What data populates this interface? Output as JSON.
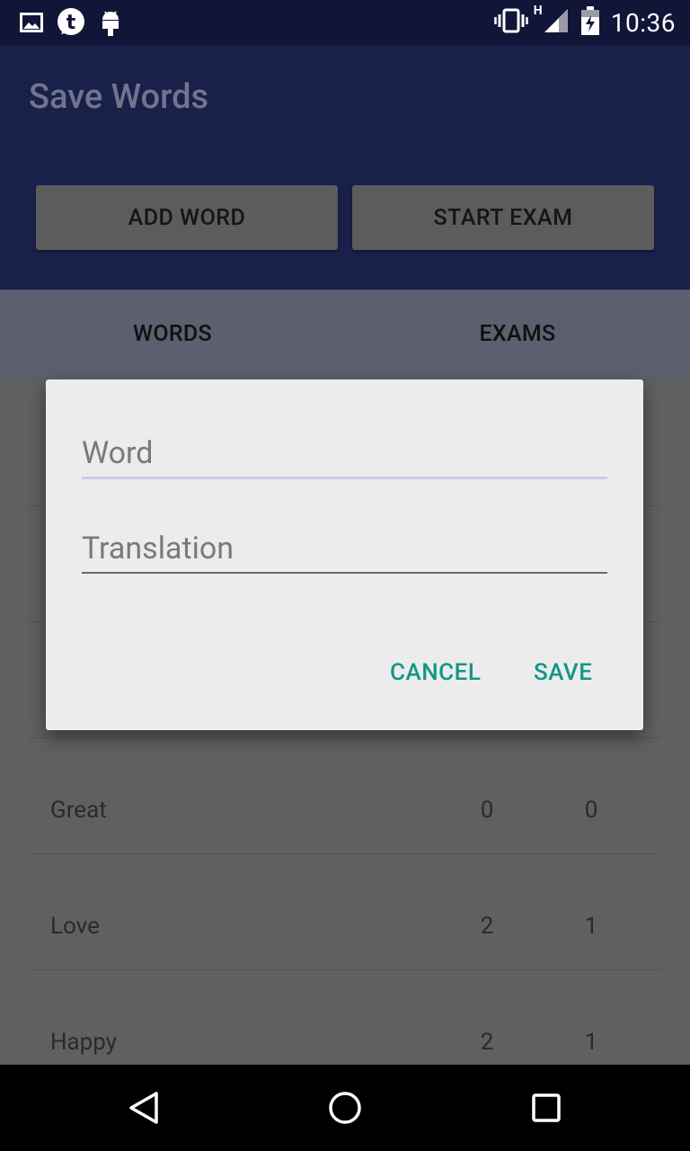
{
  "status_bar": {
    "time": "10:36",
    "network_type": "H",
    "icons_left": [
      "image-icon",
      "tumblr-icon",
      "android-icon"
    ],
    "icons_right": [
      "vibrate-icon",
      "signal-icon",
      "battery-charging-icon"
    ]
  },
  "app": {
    "title": "Save Words",
    "buttons": {
      "add_word": "ADD WORD",
      "start_exam": "START EXAM"
    },
    "tabs": [
      {
        "label": "WORDS"
      },
      {
        "label": "EXAMS"
      }
    ]
  },
  "list": {
    "rows": [
      {
        "word": "Great",
        "count1": "0",
        "count2": "0"
      },
      {
        "word": "Love",
        "count1": "2",
        "count2": "1"
      },
      {
        "word": "Happy",
        "count1": "2",
        "count2": "1"
      }
    ]
  },
  "dialog": {
    "word_placeholder": "Word",
    "word_value": "",
    "translation_placeholder": "Translation",
    "translation_value": "",
    "cancel_label": "CANCEL",
    "save_label": "SAVE"
  },
  "colors": {
    "accent": "#129688",
    "primary_dim": "#19204a",
    "status_bar": "#111538",
    "scrim_bg": "#606060"
  }
}
